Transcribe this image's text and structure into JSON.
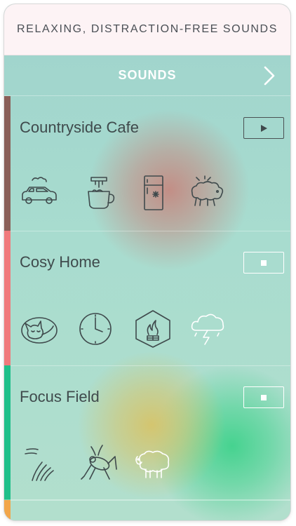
{
  "tagline": "RELAXING, DISTRACTION-FREE SOUNDS",
  "header": {
    "title": "SOUNDS",
    "next_icon": "chevron-right-icon"
  },
  "colors": {
    "stripe_countryside": "#8a5f58",
    "stripe_cosy": "#f07a7c",
    "stripe_focus": "#1fc08a",
    "stripe_next": "#f2a64a",
    "icon_stroke": "#3f4a4c",
    "white": "#ffffff"
  },
  "sections": [
    {
      "name": "Countryside Cafe",
      "control": "play-icon",
      "icons": [
        "car-icon",
        "coffee-machine-cup-icon",
        "refrigerator-icon",
        "sheep-flock-icon"
      ]
    },
    {
      "name": "Cosy Home",
      "control": "stop-icon",
      "icons": [
        "sleeping-cat-icon",
        "clock-icon",
        "fireplace-icon",
        "thunderstorm-icon"
      ]
    },
    {
      "name": "Focus Field",
      "control": "stop-icon",
      "icons": [
        "wind-icon",
        "cricket-icon",
        "sheep-icon"
      ]
    }
  ]
}
